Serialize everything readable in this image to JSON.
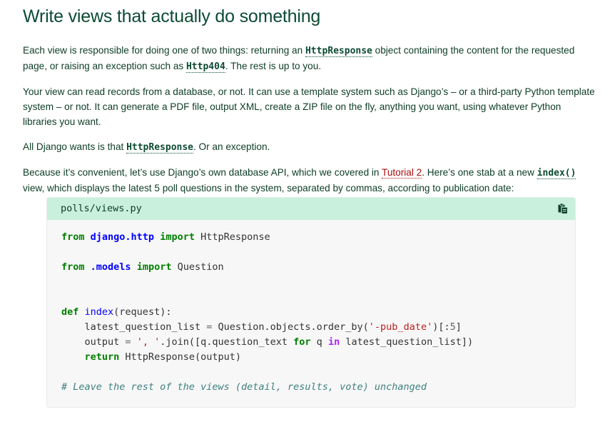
{
  "heading": "Write views that actually do something",
  "para1": {
    "t1": "Each view is responsible for doing one of two things: returning an ",
    "code1": "HttpResponse",
    "t2": " object containing the content for the requested page, or raising an exception such as ",
    "code2": "Http404",
    "t3": ". The rest is up to you."
  },
  "para2": "Your view can read records from a database, or not. It can use a template system such as Django’s – or a third-party Python template system – or not. It can generate a PDF file, output XML, create a ZIP file on the fly, anything you want, using whatever Python libraries you want.",
  "para3": {
    "t1": "All Django wants is that ",
    "code1": "HttpResponse",
    "t2": ". Or an exception."
  },
  "para4": {
    "t1": "Because it’s convenient, let’s use Django’s own database API, which we covered in ",
    "link": "Tutorial 2",
    "t2": ". Here’s one stab at a new ",
    "code1": "index()",
    "t3": " view, which displays the latest 5 poll questions in the system, separated by commas, according to publication date:"
  },
  "snippet": {
    "filename": "polls/views.py",
    "copy_icon": "clipboard-icon",
    "tokens": {
      "from": "from",
      "import": "import",
      "def": "def",
      "for": "for",
      "in": "in",
      "return": "return",
      "mod_http": "django.http",
      "mod_models": ".models",
      "cls_response": "HttpResponse",
      "cls_question": "Question",
      "fn_index": "index",
      "params": "(request):",
      "line_list_a": "latest_question_list ",
      "eq": "=",
      "line_list_b": " Question.objects.order_by(",
      "str_pub": "'-pub_date'",
      "line_list_c": ")[:",
      "num5": "5",
      "close_bracket": "]",
      "line_out_a": "output ",
      "str_sep": "', '",
      "line_out_b": ".join([q.question_text ",
      "line_out_c": " q ",
      "line_out_d": " latest_question_list])",
      "line_ret": " HttpResponse(output)",
      "comment": "# Leave the rest of the views (detail, results, vote) unchanged"
    }
  },
  "colors": {
    "heading": "#0c4b33",
    "snippet_header": "#c9f0dd",
    "link": "#ab0d0d",
    "keyword": "#008000",
    "comment": "#408080",
    "string": "#ba2121"
  }
}
